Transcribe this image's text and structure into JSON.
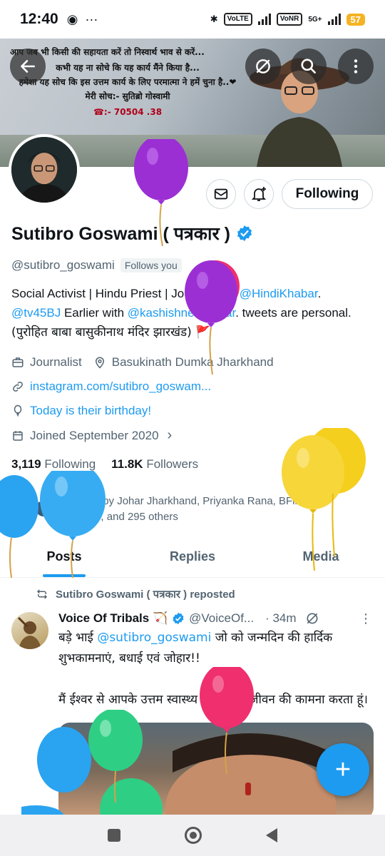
{
  "status_bar": {
    "time": "12:40",
    "network_chip_1": "Vo LTE",
    "network_chip_2": "Vo NR",
    "network_type": "5G+",
    "battery": "57"
  },
  "header": {
    "back_icon": "arrow-left-icon",
    "grok_icon": "slash-circle-icon",
    "search_icon": "search-icon",
    "more_icon": "more-vertical-icon"
  },
  "banner": {
    "line1": "आप जब भी किसी की सहायता करें तो निस्वार्थ भाव से करें...",
    "line2": "कभी यह ना सोचे कि यह कार्य मैंने किया है...",
    "line3": "हमेशा यह सोच कि इस उत्तम कार्य के लिए परमात्मा ने हमें चुना है..❤",
    "line4": "मेरी सोच:- सुतिब्रो गोस्वामी",
    "phone": "☎:- 70504 .38"
  },
  "profile": {
    "name": "Sutibro Goswami ( पत्रकार )",
    "handle": "@sutibro_goswami",
    "follows_you": "Follows you",
    "follow_button": "Following",
    "bio_part1": "Social Activist | Hindu Priest | Journalist in ",
    "bio_link1": "@HindiKhabar",
    "bio_part2": ". ",
    "bio_link2": "@tv45BJ",
    "bio_part3": "  Earlier with ",
    "bio_link3": "@kashishnewsbihar",
    "bio_part4": ". tweets are personal.",
    "bio_line3": "(पुरोहित बाबा बासुकीनाथ मंदिर झारखंड) 🚩",
    "category": "Journalist",
    "location": "Basukinath Dumka Jharkhand",
    "website": "instagram.com/sutibro_goswam...",
    "birthday": "Today is their birthday!",
    "joined": "Joined September 2020",
    "following_count": "3,119",
    "following_label": "Following",
    "followers_count": "11.8K",
    "followers_label": "Followers",
    "followed_by": "Followed by Johar Jharkhand, Priyanka Rana, BFilmy Boxoffice, and 295 others"
  },
  "tabs": [
    {
      "label": "Posts"
    },
    {
      "label": "Replies"
    },
    {
      "label": "Media"
    }
  ],
  "post": {
    "repost_label": "Sutibro Goswami ( पत्रकार ) reposted",
    "author": "Voice Of Tribals 🏹",
    "handle": "@VoiceOf...",
    "time": "· 34m",
    "text_1": "बड़े भाई ",
    "text_link": "@sutibro_goswami",
    "text_2": " जो को जन्मदिन की हार्दिक शुभकामनाएं, बधाई एवं जोहार!!",
    "text_3": "मैं ईश्वर से आपके उत्तम स्वास्थ्य एवं दीर्घायु जीवन की कामना करता हूं।"
  },
  "fab": {
    "label": "+"
  },
  "colors": {
    "accent": "#1d9bf0",
    "balloon_purple": "#9b2fd4",
    "balloon_yellow": "#f5cf1e",
    "balloon_blue": "#2aa3f0",
    "balloon_pink": "#ef2f6e",
    "balloon_green": "#2ecf84"
  }
}
